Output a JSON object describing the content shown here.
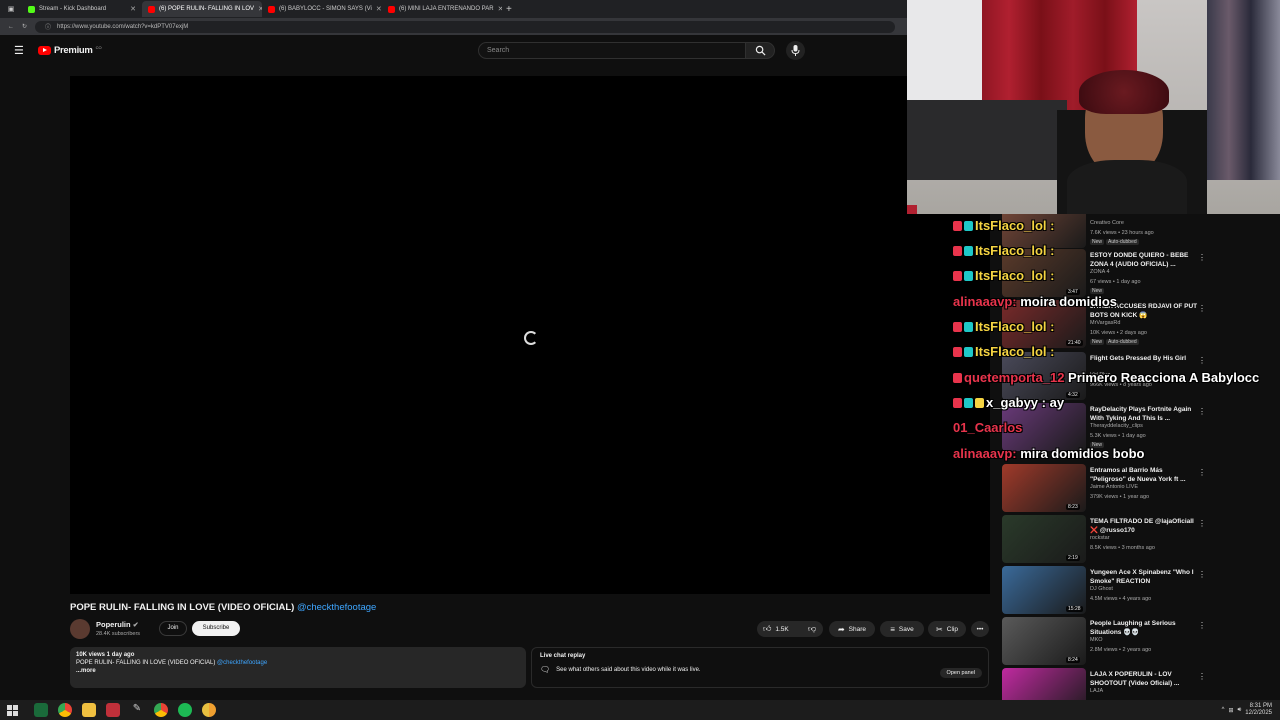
{
  "browser": {
    "tabs": [
      {
        "label": "Stream - Kick Dashboard",
        "color": "#53fc18"
      },
      {
        "label": "(6) POPE RULIN- FALLING IN LOV",
        "color": "#ff0000"
      },
      {
        "label": "(6) BABYLOCC - SIMON SAYS (Vi",
        "color": "#ff0000"
      },
      {
        "label": "(6) MINI LAJA ENTRENANDO PAR",
        "color": "#ff0000"
      }
    ],
    "new_tab": "+",
    "url": "https://www.youtube.com/watch?v=kdPTV07exjM"
  },
  "youtube": {
    "logo_text": "Premium",
    "logo_sup": "CO",
    "search_placeholder": "Search",
    "video_title": "POPE RULIN- FALLING IN LOVE (VIDEO OFICIAL)",
    "video_title_handle": "@checkthefootage",
    "channel": {
      "name": "Poperulin",
      "subs": "28.4K subscribers"
    },
    "join_label": "Join",
    "subscribe_label": "Subscribe",
    "actions": {
      "likes": "1.5K",
      "share": "Share",
      "save": "Save",
      "clip": "Clip"
    },
    "description": {
      "meta": "10K views  1 day ago",
      "line": "POPE RULIN- FALLING IN LOVE (VIDEO OFICIAL)",
      "handle": "@checkthefootage",
      "more": "...more"
    },
    "live_chat": {
      "title": "Live chat replay",
      "text": "See what others said about this video while it was live.",
      "button": "Open panel"
    },
    "recommendations": [
      {
        "title": "",
        "channel": "Creativo Core",
        "meta": "7.6K views • 23 hours ago",
        "tag": "New",
        "tag2": "Auto-dubbed",
        "color": "#7a4a3a"
      },
      {
        "title": "ESTOY DONDE QUIERO - BEBE ZONA 4 (AUDIO OFICIAL) ...",
        "channel": "ZONA 4",
        "meta": "67 views • 1 day ago",
        "tag": "New",
        "duration": "3:47",
        "color": "#5a3a2a"
      },
      {
        "title": "JAVIER ACCUSES RDJAVI OF PUT BOTS ON KICK 😱",
        "channel": "MrVargasRd",
        "meta": "10K views • 2 days ago",
        "tag": "New",
        "tag2": "Auto-dubbed",
        "duration": "21:40",
        "color": "#7a2a2a"
      },
      {
        "title": "Flight Gets Pressed By His Girl",
        "channel": "Vid Plug",
        "meta": "966K views • 8 years ago",
        "duration": "4:32",
        "color": "#4a4a5a"
      },
      {
        "title": "RayDelacity Plays Fortnite Again With Tyking And This Is ...",
        "channel": "Therayddelacity_clips",
        "meta": "5.3K views • 1 day ago",
        "tag": "New",
        "color": "#6a3a7a"
      },
      {
        "title": "Entramos al Barrio Más \"Peligroso\" de Nueva York ft ...",
        "channel": "Jaime Antonio LIVE",
        "meta": "379K views • 1 year ago",
        "duration": "8:23",
        "color": "#a03a2a"
      },
      {
        "title": "TEMA FILTRADO DE @lajaOficiall ❌ @russo170",
        "channel": "rockstar",
        "meta": "8.5K views • 3 months ago",
        "duration": "2:19",
        "color": "#2a3a2a"
      },
      {
        "title": "Yungeen Ace X Spinabenz \"Who I Smoke\" REACTION",
        "channel": "DJ Ghost",
        "meta": "4.5M views • 4 years ago",
        "duration": "15:28",
        "color": "#3a6a9a"
      },
      {
        "title": "People Laughing at Serious Situations 💀💀",
        "channel": "MKO",
        "meta": "2.8M views • 2 years ago",
        "duration": "8:24",
        "color": "#5a5a5a"
      },
      {
        "title": "LAJA X POPERULIN - LOV SHOOTOUT (Video Oficial) ...",
        "channel": "LAJA",
        "meta": "",
        "color": "#c02aa0"
      }
    ]
  },
  "chat_overlay": [
    {
      "user": "ItsFlaco_lol",
      "sep": " :",
      "msg": "",
      "color": "#f5d442",
      "badges": 2
    },
    {
      "user": "ItsFlaco_lol",
      "sep": " :",
      "msg": "",
      "color": "#f5d442",
      "badges": 2
    },
    {
      "user": "ItsFlaco_lol",
      "sep": " :",
      "msg": "",
      "color": "#f5d442",
      "badges": 2
    },
    {
      "user": "alinaaavp",
      "sep": ":",
      "msg": " moira domidios",
      "color": "#e8344c",
      "badges": 0
    },
    {
      "user": "ItsFlaco_lol",
      "sep": " :",
      "msg": "",
      "color": "#f5d442",
      "badges": 2
    },
    {
      "user": "ItsFlaco_lol",
      "sep": " :",
      "msg": "",
      "color": "#f5d442",
      "badges": 2
    },
    {
      "user": "quetemporta_12",
      "sep": "",
      "msg": " Primero Reacciona A Babylocc",
      "color": "#e8344c",
      "badges": 1
    },
    {
      "user": "x_gabyy",
      "sep": " :",
      "msg": " ay",
      "color": "#ffffff",
      "badges": 3
    },
    {
      "user": "01_Caarlos",
      "sep": "",
      "msg": "",
      "color": "#e8344c",
      "badges": 0
    },
    {
      "user": "alinaaavp",
      "sep": ":",
      "msg": " mira domidios bobo",
      "color": "#e8344c",
      "badges": 0
    }
  ],
  "taskbar": {
    "time": "8:31 PM",
    "date": "12/2/2025"
  }
}
